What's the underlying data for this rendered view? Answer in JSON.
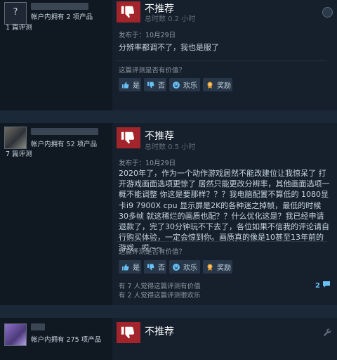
{
  "reviews": [
    {
      "avatar_glyph": "?",
      "owned": "帐户内拥有 2 项产品",
      "review_count": "1 篇评测",
      "verdict": "不推荐",
      "hours": "总时数 0.2 小时",
      "posted": "发布于：10月29日",
      "text": "分辨率都调不了，我也是服了",
      "helpful_question": "这篇评测是否有价值？",
      "buttons": {
        "yes": "是",
        "no": "否",
        "funny": "欢乐",
        "award": "奖励"
      }
    },
    {
      "owned": "帐户内拥有 52 项产品",
      "review_count": "7 篇评测",
      "verdict": "不推荐",
      "hours": "总时数 0.5 小时",
      "posted": "发布于：10月29日",
      "text": "2020年了，作为一个动作游戏居然不能改建位让我惊呆了 打开游戏画面选项更惊了 居然只能更改分辨率，其他画面选项一概不能调整 你这是要那样？？？我电脑配置不算低的 1080显卡i9 7900X cpu 显示屏是2K的各种迷之掉帧，最低的时候30多帧 就这稀烂的画质也配？？什么优化这是？我已经申请退款了，完了30分钟玩不下去了，各位如果不信我的评论请自行购买体验，一定会惊到你。画质真的像是10甚至13年前的游戏。哎~~",
      "helpful_question": "这篇评测是否有价值？",
      "buttons": {
        "yes": "是",
        "no": "否",
        "funny": "欢乐",
        "award": "奖励"
      },
      "helpful_stat": "有 7 人觉得这篇评测有价值",
      "funny_stat": "有 2 人觉得这篇评测很欢乐",
      "comment_count": "2"
    },
    {
      "owned": "帐户内拥有 275 项产品",
      "verdict": "不推荐"
    }
  ],
  "colors": {
    "not_recommended": "#a3252b",
    "link": "#67c1f5",
    "background": "#1b2838",
    "panel": "#16202d"
  },
  "icons": [
    "thumbs-down-icon",
    "thumbs-up-icon",
    "laugh-icon",
    "award-icon",
    "steam-logo-icon",
    "comment-icon"
  ]
}
